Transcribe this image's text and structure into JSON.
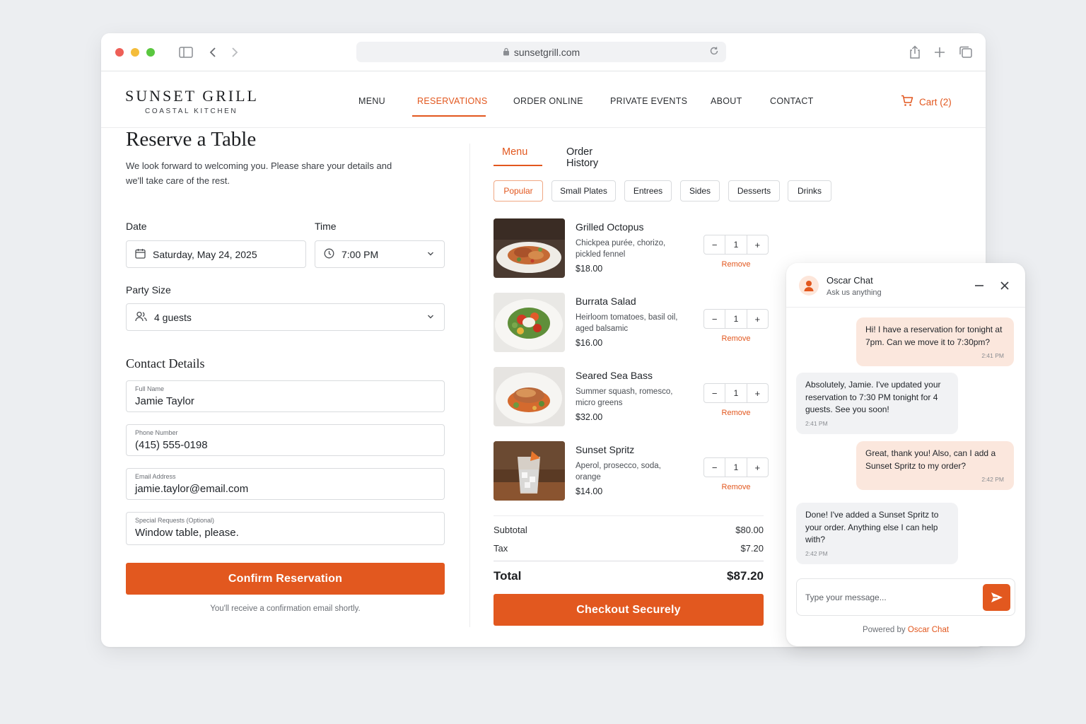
{
  "browser": {
    "url": "sunsetgrill.com"
  },
  "site": {
    "logo_main": "SUNSET GRILL",
    "logo_sub": "COASTAL KITCHEN",
    "nav": [
      "MENU",
      "RESERVATIONS",
      "ORDER ONLINE",
      "PRIVATE EVENTS",
      "ABOUT",
      "CONTACT"
    ],
    "nav_active": "RESERVATIONS",
    "cart_label": "Cart (2)",
    "accent_color": "#e2571e"
  },
  "reservation": {
    "title": "Reserve a Table",
    "intro": "We look forward to welcoming you. Please share your details and we'll take care of the rest.",
    "date_label": "Date",
    "date_value": "Saturday, May 24, 2025",
    "time_label": "Time",
    "time_value": "7:00 PM",
    "party_label": "Party Size",
    "party_value": "4 guests",
    "contact_title": "Contact Details",
    "fields": [
      {
        "label": "Full Name",
        "value": "Jamie Taylor"
      },
      {
        "label": "Phone Number",
        "value": "(415) 555-0198"
      },
      {
        "label": "Email Address",
        "value": "jamie.taylor@email.com"
      },
      {
        "label": "Special Requests (Optional)",
        "value": "Window table, please."
      }
    ],
    "confirm_label": "Confirm Reservation",
    "note": "You'll receive a confirmation email shortly."
  },
  "order": {
    "tabs": [
      "Menu",
      "Order History"
    ],
    "active_tab": "Menu",
    "chips": [
      "Popular",
      "Small Plates",
      "Entrees",
      "Sides",
      "Desserts",
      "Drinks"
    ],
    "active_chip": "Popular",
    "items": [
      {
        "name": "Grilled Octopus",
        "desc": "Chickpea purée, chorizo, pickled fennel",
        "price": "$18.00",
        "qty": "1",
        "remove": "Remove"
      },
      {
        "name": "Burrata Salad",
        "desc": "Heirloom tomatoes, basil oil, aged balsamic",
        "price": "$16.00",
        "qty": "1",
        "remove": "Remove"
      },
      {
        "name": "Seared Sea Bass",
        "desc": "Summer squash, romesco, micro greens",
        "price": "$32.00",
        "qty": "1",
        "remove": "Remove"
      },
      {
        "name": "Sunset Spritz",
        "desc": "Aperol, prosecco, soda, orange",
        "price": "$14.00",
        "qty": "1",
        "remove": "Remove"
      }
    ],
    "minus": "−",
    "plus": "+",
    "subtotal_label": "Subtotal",
    "subtotal_value": "$80.00",
    "tax_label": "Tax",
    "tax_value": "$7.20",
    "total_label": "Total",
    "total_value": "$87.20",
    "checkout_label": "Checkout Securely"
  },
  "chat": {
    "title": "Oscar Chat",
    "subtitle": "Ask us anything",
    "messages": [
      {
        "from": "user",
        "text": "Hi! I have a reservation for tonight at 7pm. Can we move it to 7:30pm?",
        "time": "2:41 PM"
      },
      {
        "from": "agent",
        "text": "Absolutely, Jamie. I've updated your reservation to 7:30 PM tonight for 4 guests. See you soon!",
        "time": "2:41 PM"
      },
      {
        "from": "user",
        "text": "Great, thank you! Also, can I add a Sunset Spritz to my order?",
        "time": "2:42 PM"
      },
      {
        "from": "agent",
        "text": "Done! I've added a Sunset Spritz to your order. Anything else I can help with?",
        "time": "2:42 PM"
      }
    ],
    "input_placeholder": "Type your message...",
    "powered_prefix": "Powered by",
    "powered_brand": "Oscar Chat"
  }
}
